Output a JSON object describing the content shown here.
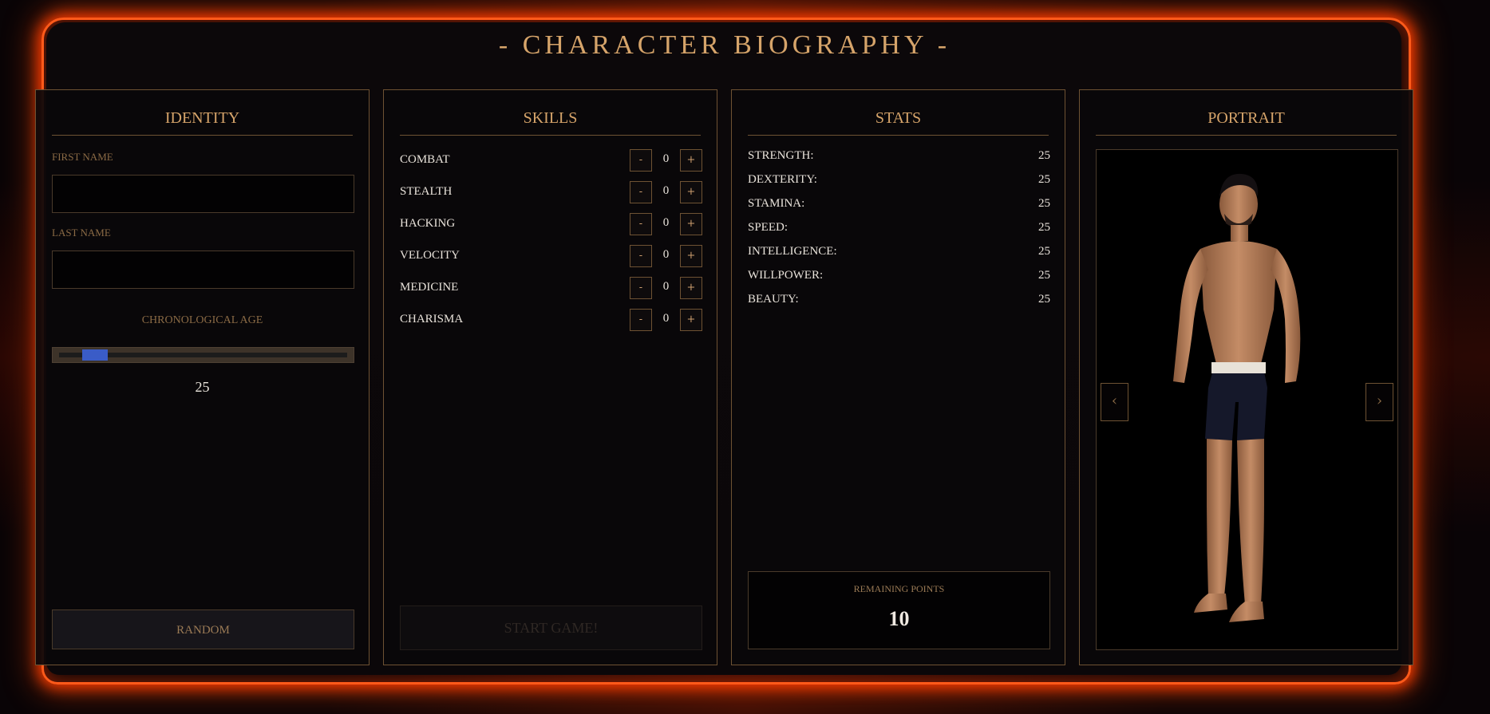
{
  "title": "- CHARACTER BIOGRAPHY -",
  "identity": {
    "header": "IDENTITY",
    "first_name_label": "FIRST NAME",
    "first_name_value": "",
    "last_name_label": "LAST NAME",
    "last_name_value": "",
    "age_label": "CHRONOLOGICAL AGE",
    "age_value": "25",
    "random_label": "RANDOM"
  },
  "skills": {
    "header": "SKILLS",
    "minus_label": "-",
    "plus_label": "+",
    "items": [
      {
        "name": "COMBAT",
        "value": "0"
      },
      {
        "name": "STEALTH",
        "value": "0"
      },
      {
        "name": "HACKING",
        "value": "0"
      },
      {
        "name": "VELOCITY",
        "value": "0"
      },
      {
        "name": "MEDICINE",
        "value": "0"
      },
      {
        "name": "CHARISMA",
        "value": "0"
      }
    ],
    "start_label": "START GAME!"
  },
  "stats": {
    "header": "STATS",
    "items": [
      {
        "name": "STRENGTH:",
        "value": "25"
      },
      {
        "name": "DEXTERITY:",
        "value": "25"
      },
      {
        "name": "STAMINA:",
        "value": "25"
      },
      {
        "name": "SPEED:",
        "value": "25"
      },
      {
        "name": "INTELLIGENCE:",
        "value": "25"
      },
      {
        "name": "WILLPOWER:",
        "value": "25"
      },
      {
        "name": "BEAUTY:",
        "value": "25"
      }
    ],
    "remaining_label": "REMAINING POINTS",
    "remaining_value": "10"
  },
  "portrait": {
    "header": "PORTRAIT",
    "prev_icon": "‹",
    "next_icon": "›"
  },
  "colors": {
    "accent": "#d6a46a",
    "frame_glow": "#ff5a1a",
    "slider_thumb": "#3a5cc7"
  }
}
